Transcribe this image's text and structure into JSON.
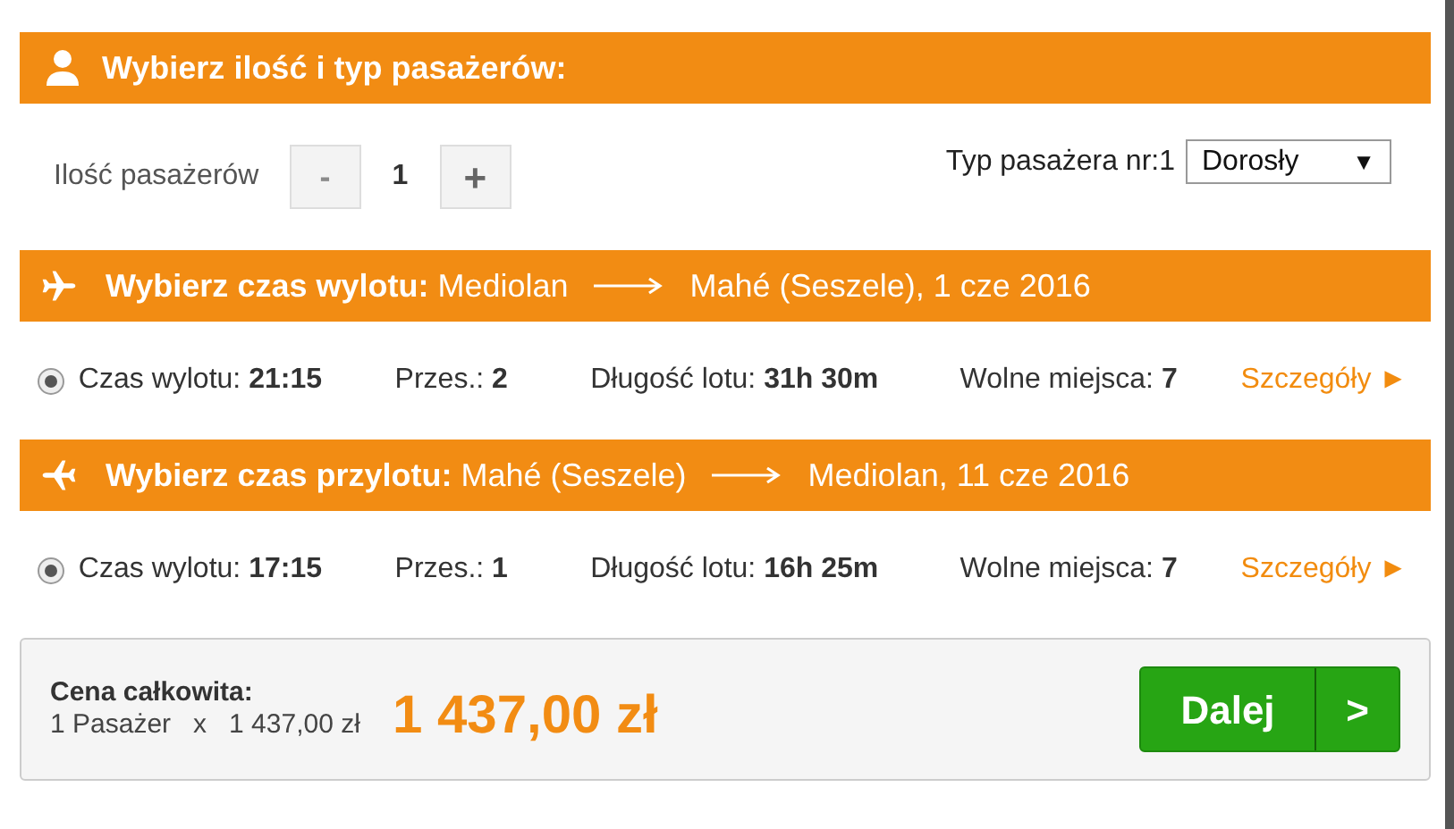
{
  "passengers_header": {
    "title": "Wybierz ilość i typ pasażerów:"
  },
  "passenger_count": {
    "label": "Ilość pasażerów",
    "minus": "-",
    "value": "1",
    "plus": "+",
    "minus_disabled": true
  },
  "passenger_type": {
    "label": "Typ pasażera nr:1",
    "value": "Dorosły",
    "caret": "▼"
  },
  "flights": [
    {
      "kind": "departure",
      "title_bold": "Wybierz czas wylotu:",
      "from": "Mediolan",
      "to": "Mahé (Seszele), 1 cze 2016",
      "selected": true,
      "time_label": "Czas wylotu:",
      "time": "21:15",
      "stops_label": "Przes.:",
      "stops": "2",
      "duration_label": "Długość lotu:",
      "duration": "31h 30m",
      "seats_label": "Wolne miejsca:",
      "seats": "7",
      "details": "Szczegóły ►"
    },
    {
      "kind": "return",
      "title_bold": "Wybierz czas przylotu:",
      "from": "Mahé (Seszele)",
      "to": "Mediolan, 11 cze 2016",
      "selected": true,
      "time_label": "Czas wylotu:",
      "time": "17:15",
      "stops_label": "Przes.:",
      "stops": "1",
      "duration_label": "Długość lotu:",
      "duration": "16h 25m",
      "seats_label": "Wolne miejsca:",
      "seats": "7",
      "details": "Szczegóły ►"
    }
  ],
  "summary": {
    "label": "Cena całkowita:",
    "passengers": "1 Pasażer",
    "times": "x",
    "unit_price": "1 437,00 zł",
    "total": "1 437,00 zł",
    "next_button": "Dalej",
    "next_arrow": ">"
  }
}
